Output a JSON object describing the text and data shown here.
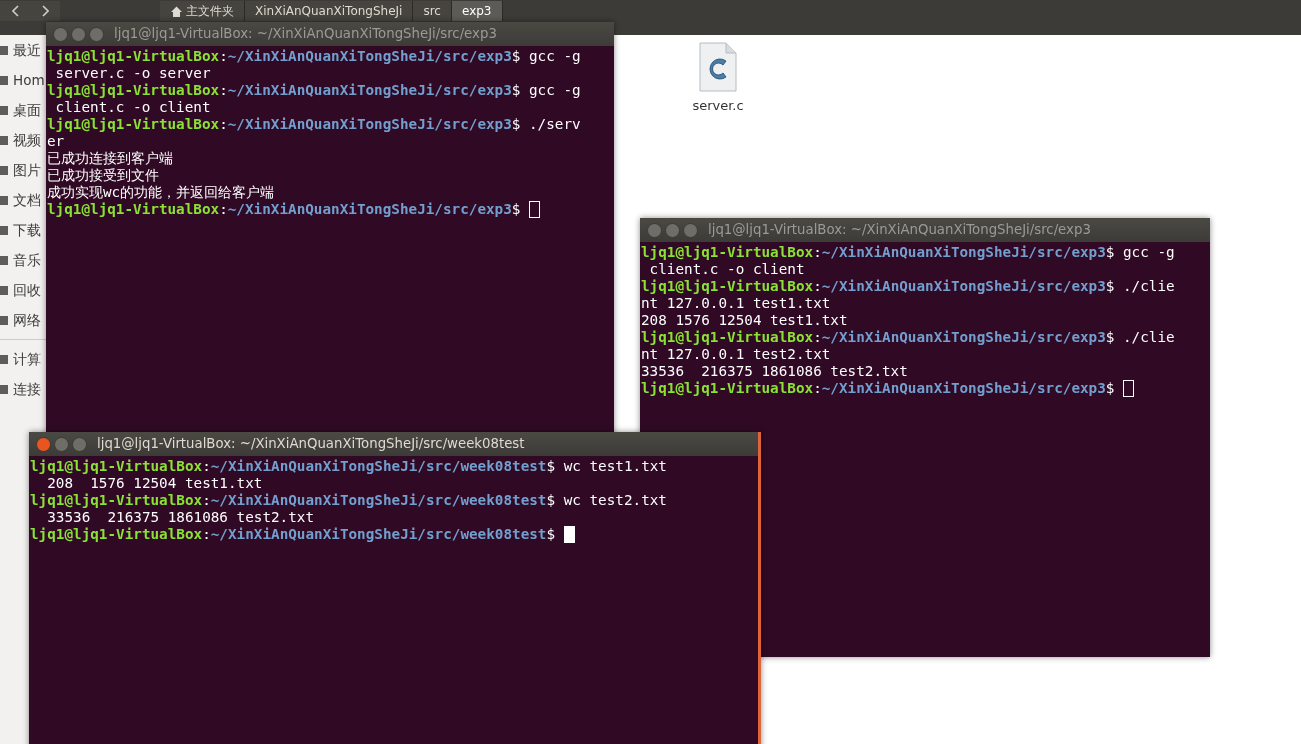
{
  "file_manager": {
    "breadcrumbs": [
      {
        "label": "主文件夹",
        "kind": "home",
        "selected": false
      },
      {
        "label": "XinXiAnQuanXiTongSheJi",
        "kind": "folder",
        "selected": false
      },
      {
        "label": "src",
        "kind": "folder",
        "selected": false
      },
      {
        "label": "exp3",
        "kind": "folder",
        "selected": true
      }
    ],
    "sidebar": [
      {
        "label": "最近",
        "kind": "place"
      },
      {
        "label": "Hom",
        "kind": "place"
      },
      {
        "label": "桌面",
        "kind": "place"
      },
      {
        "label": "视频",
        "kind": "place"
      },
      {
        "label": "图片",
        "kind": "place"
      },
      {
        "label": "文档",
        "kind": "place"
      },
      {
        "label": "下载",
        "kind": "place"
      },
      {
        "label": "音乐",
        "kind": "place"
      },
      {
        "label": "回收",
        "kind": "place"
      },
      {
        "label": "网络",
        "kind": "place"
      },
      {
        "kind": "divider"
      },
      {
        "label": "计算",
        "kind": "place"
      },
      {
        "label": "连接",
        "kind": "place"
      }
    ],
    "files": [
      {
        "label": "server.c"
      }
    ]
  },
  "terminals": [
    {
      "title": "ljq1@ljq1-VirtualBox: ~/XinXiAnQuanXiTongSheJi/src/exp3",
      "focused": false,
      "lines": [
        {
          "kind": "prompt",
          "user": "ljq1@ljq1-VirtualBox",
          "separator": ":",
          "path": "~/XinXiAnQuanXiTongSheJi/src/exp3",
          "symbol": "$",
          "command": "gcc -g"
        },
        {
          "kind": "output",
          "text": " server.c -o server"
        },
        {
          "kind": "prompt",
          "user": "ljq1@ljq1-VirtualBox",
          "separator": ":",
          "path": "~/XinXiAnQuanXiTongSheJi/src/exp3",
          "symbol": "$",
          "command": "gcc -g"
        },
        {
          "kind": "output",
          "text": " client.c -o client"
        },
        {
          "kind": "prompt",
          "user": "ljq1@ljq1-VirtualBox",
          "separator": ":",
          "path": "~/XinXiAnQuanXiTongSheJi/src/exp3",
          "symbol": "$",
          "command": "./serv"
        },
        {
          "kind": "output",
          "text": "er"
        },
        {
          "kind": "output",
          "text": "已成功连接到客户端"
        },
        {
          "kind": "output",
          "text": "已成功接受到文件"
        },
        {
          "kind": "output",
          "text": "成功实现wc的功能，并返回给客户端"
        },
        {
          "kind": "prompt",
          "user": "ljq1@ljq1-VirtualBox",
          "separator": ":",
          "path": "~/XinXiAnQuanXiTongSheJi/src/exp3",
          "symbol": "$",
          "cursor": true
        }
      ]
    },
    {
      "title": "ljq1@ljq1-VirtualBox: ~/XinXiAnQuanXiTongSheJi/src/exp3",
      "focused": false,
      "lines": [
        {
          "kind": "prompt",
          "user": "ljq1@ljq1-VirtualBox",
          "separator": ":",
          "path": "~/XinXiAnQuanXiTongSheJi/src/exp3",
          "symbol": "$",
          "command": "gcc -g"
        },
        {
          "kind": "output",
          "text": " client.c -o client"
        },
        {
          "kind": "prompt",
          "user": "ljq1@ljq1-VirtualBox",
          "separator": ":",
          "path": "~/XinXiAnQuanXiTongSheJi/src/exp3",
          "symbol": "$",
          "command": "./clie"
        },
        {
          "kind": "output",
          "text": "nt 127.0.0.1 test1.txt"
        },
        {
          "kind": "output",
          "text": "208 1576 12504 test1.txt"
        },
        {
          "kind": "prompt",
          "user": "ljq1@ljq1-VirtualBox",
          "separator": ":",
          "path": "~/XinXiAnQuanXiTongSheJi/src/exp3",
          "symbol": "$",
          "command": "./clie"
        },
        {
          "kind": "output",
          "text": "nt 127.0.0.1 test2.txt"
        },
        {
          "kind": "output",
          "text": "33536  216375 1861086 test2.txt"
        },
        {
          "kind": "prompt",
          "user": "ljq1@ljq1-VirtualBox",
          "separator": ":",
          "path": "~/XinXiAnQuanXiTongSheJi/src/exp3",
          "symbol": "$",
          "cursor": true
        }
      ]
    },
    {
      "title": "ljq1@ljq1-VirtualBox: ~/XinXiAnQuanXiTongSheJi/src/week08test",
      "focused": true,
      "lines": [
        {
          "kind": "prompt",
          "user": "ljq1@ljq1-VirtualBox",
          "separator": ":",
          "path": "~/XinXiAnQuanXiTongSheJi/src/week08test",
          "symbol": "$",
          "command": "wc test1.txt"
        },
        {
          "kind": "output",
          "text": "  208  1576 12504 test1.txt"
        },
        {
          "kind": "prompt",
          "user": "ljq1@ljq1-VirtualBox",
          "separator": ":",
          "path": "~/XinXiAnQuanXiTongSheJi/src/week08test",
          "symbol": "$",
          "command": "wc test2.txt"
        },
        {
          "kind": "output",
          "text": "  33536  216375 1861086 test2.txt"
        },
        {
          "kind": "prompt",
          "user": "ljq1@ljq1-VirtualBox",
          "separator": ":",
          "path": "~/XinXiAnQuanXiTongSheJi/src/week08test",
          "symbol": "$",
          "cursor": true
        }
      ]
    }
  ]
}
